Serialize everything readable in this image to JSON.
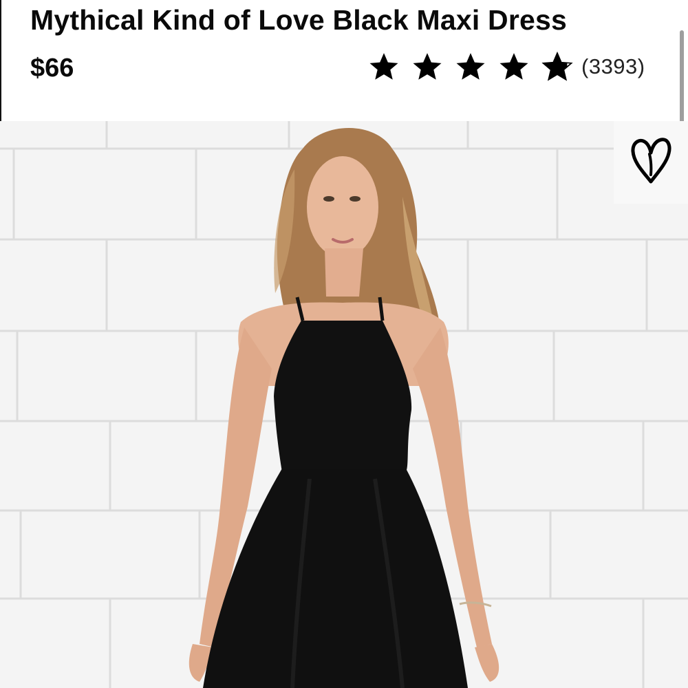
{
  "product": {
    "title": "Mythical Kind of Love Black Maxi Dress",
    "price": "$66",
    "rating": 4.8,
    "rating_max": 5,
    "review_count": "(3393)"
  },
  "icons": {
    "rating": "star-icon",
    "favorite": "heart-outline-icon"
  },
  "colors": {
    "text": "#0a0a0a",
    "star": "#000000",
    "dress": "#111111",
    "background_wall": "#f3f3f3"
  }
}
